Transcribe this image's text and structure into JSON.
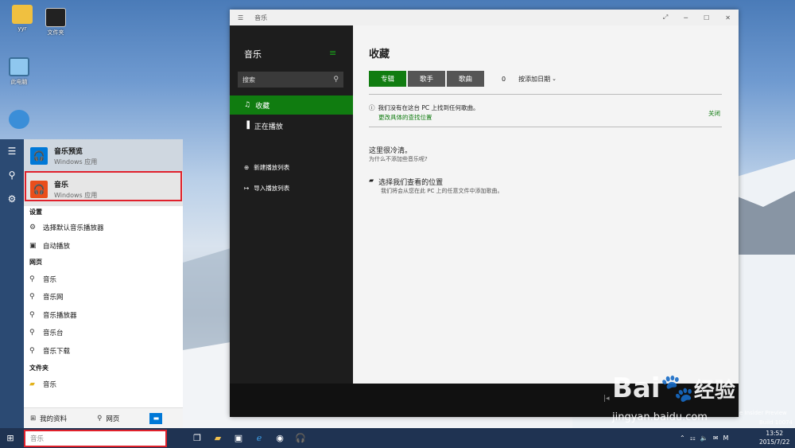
{
  "desktop": {
    "icons": [
      {
        "label": "yyr"
      },
      {
        "label": "文件夹"
      },
      {
        "label": "此电脑"
      },
      {
        "label": "网络"
      }
    ]
  },
  "start_menu": {
    "best_match": [
      {
        "name": "音乐预览",
        "sub": "Windows 应用"
      },
      {
        "name": "音乐",
        "sub": "Windows 应用"
      }
    ],
    "sections": {
      "settings": {
        "header": "设置",
        "items": [
          "选择默认音乐播放器",
          "自动播放"
        ]
      },
      "web": {
        "header": "网页",
        "items": [
          "音乐",
          "音乐网",
          "音乐播放器",
          "音乐台",
          "音乐下载"
        ]
      },
      "folders": {
        "header": "文件夹",
        "items": [
          "音乐"
        ]
      }
    },
    "bottom": {
      "my_stuff": "我的资料",
      "web": "网页"
    }
  },
  "search": {
    "value": "音乐"
  },
  "music_app": {
    "title": "音乐",
    "app_name": "音乐",
    "search_placeholder": "搜索",
    "nav": [
      {
        "label": "收藏",
        "icon": "music-note-icon"
      },
      {
        "label": "正在播放",
        "icon": "bars-icon"
      }
    ],
    "actions": [
      {
        "label": "新建播放列表",
        "icon": "plus-circle-icon"
      },
      {
        "label": "导入播放列表",
        "icon": "import-icon"
      }
    ],
    "main": {
      "heading": "收藏",
      "tabs": [
        "专辑",
        "歌手",
        "歌曲"
      ],
      "count": "0",
      "sort": "按添加日期",
      "notice": "我们没有在这台 PC 上找到任何歌曲。",
      "notice_link": "更改具体的查找位置",
      "close": "关闭",
      "empty_title": "这里很冷清。",
      "empty_sub": "为什么不添加些音乐呢?",
      "choose_title": "选择我们查看的位置",
      "choose_sub": "我们将会从您在此 PC 上的任意文件中添加歌曲。"
    }
  },
  "taskbar": {
    "time": "13:52",
    "date": "2015/7/22",
    "build": "Build 10074",
    "insider": "e Insider Preview"
  },
  "watermark": {
    "brand": "Bai",
    "brand2": "经验",
    "url": "jingyan.baidu.com"
  },
  "colors": {
    "accent": "#107c10",
    "highlight": "#e0212c",
    "app_tile": "#0078d7",
    "music_tile": "#e94e1b"
  }
}
